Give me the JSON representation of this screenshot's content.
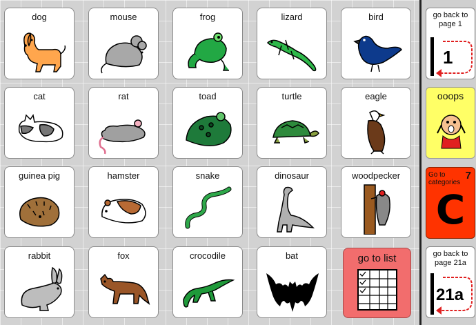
{
  "animals": [
    {
      "label": "dog",
      "icon": "dog-icon"
    },
    {
      "label": "mouse",
      "icon": "mouse-icon"
    },
    {
      "label": "frog",
      "icon": "frog-icon"
    },
    {
      "label": "lizard",
      "icon": "lizard-icon"
    },
    {
      "label": "bird",
      "icon": "bird-icon"
    },
    {
      "label": "cat",
      "icon": "cat-icon"
    },
    {
      "label": "rat",
      "icon": "rat-icon"
    },
    {
      "label": "toad",
      "icon": "toad-icon"
    },
    {
      "label": "turtle",
      "icon": "turtle-icon"
    },
    {
      "label": "eagle",
      "icon": "eagle-icon"
    },
    {
      "label": "guinea pig",
      "icon": "guinea-pig-icon"
    },
    {
      "label": "hamster",
      "icon": "hamster-icon"
    },
    {
      "label": "snake",
      "icon": "snake-icon"
    },
    {
      "label": "dinosaur",
      "icon": "dinosaur-icon"
    },
    {
      "label": "woodpecker",
      "icon": "woodpecker-icon"
    },
    {
      "label": "rabbit",
      "icon": "rabbit-icon"
    },
    {
      "label": "fox",
      "icon": "fox-icon"
    },
    {
      "label": "crocodile",
      "icon": "crocodile-icon"
    },
    {
      "label": "bat",
      "icon": "bat-icon"
    }
  ],
  "go_to_list": {
    "label": "go to list",
    "icon": "list-table-icon",
    "color": "#f26d6d"
  },
  "sidebar": {
    "back_page1": {
      "label": "go back to page 1",
      "badge": "1",
      "icon": "return-arrow-icon"
    },
    "ooops": {
      "label": "ooops",
      "icon": "surprised-face-icon",
      "color": "#ffff66"
    },
    "categories": {
      "label": "Go to categories",
      "number": "7",
      "letter": "C",
      "color": "#ff3300"
    },
    "back_page21a": {
      "label": "go back to page 21a",
      "badge": "21a",
      "icon": "return-arrow-icon"
    }
  }
}
